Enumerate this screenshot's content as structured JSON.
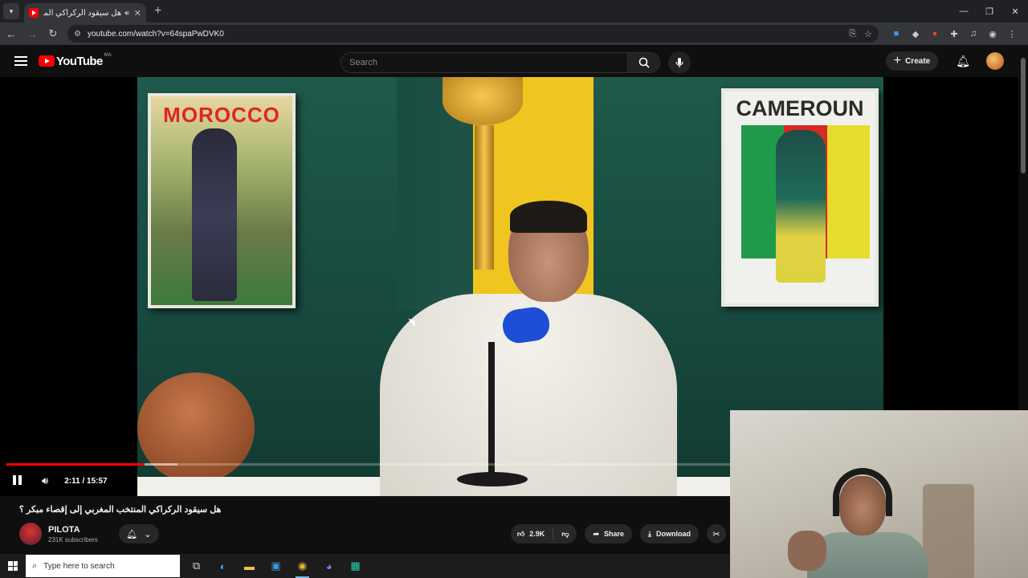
{
  "browser": {
    "tab": {
      "title": "هل سيقود الركراكي المنتخ",
      "close_label": "✕"
    },
    "new_tab_label": "+",
    "window_controls": {
      "minimize": "—",
      "restore": "❐",
      "close": "✕"
    },
    "url": "youtube.com/watch?v=64spaPwDVK0"
  },
  "youtube": {
    "logo_text": "YouTube",
    "country_code": "MA",
    "search_placeholder": "Search",
    "create_label": "Create"
  },
  "player": {
    "poster_left_text": "MOROCCO",
    "poster_right_text": "CAMEROUN",
    "time_display": "2:11 / 15:57",
    "progress_fraction": 0.137,
    "buffered_fraction": 0.17,
    "state": "playing"
  },
  "video": {
    "title": "هل سيقود الركراكي المنتخب المغربي إلى إقصاء مبكر ؟",
    "channel_name": "PILOTA",
    "subscribers": "231K subscribers",
    "likes": "2.9K",
    "share_label": "Share",
    "download_label": "Download"
  },
  "taskbar": {
    "search_placeholder": "Type here to search"
  },
  "colors": {
    "brand_red": "#ff0000",
    "background": "#0f0f0f",
    "pill": "#272727"
  },
  "icons": {
    "back": "back-arrow-icon",
    "forward": "forward-arrow-icon",
    "reload": "reload-icon",
    "search": "search-icon",
    "mic": "microphone-icon",
    "bell": "bell-icon",
    "like": "thumbs-up-icon",
    "dislike": "thumbs-down-icon",
    "share": "share-icon",
    "download": "download-icon",
    "clip": "scissors-icon"
  }
}
